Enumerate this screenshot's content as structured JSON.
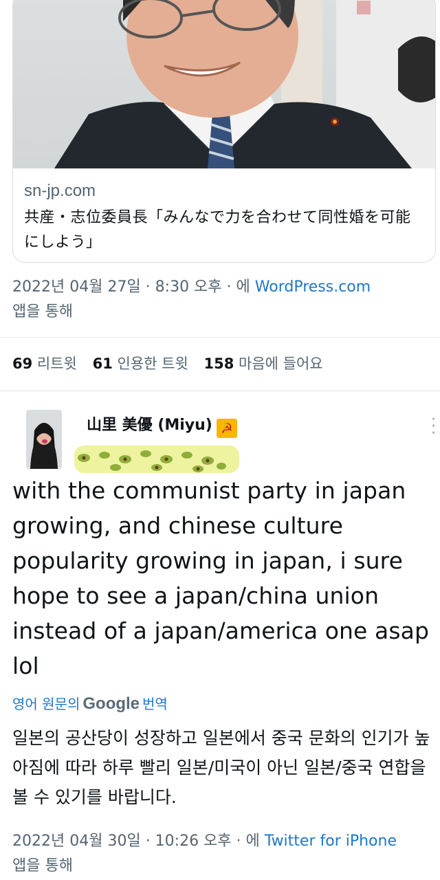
{
  "link_card": {
    "domain": "sn-jp.com",
    "title": "共産・志位委員長「みんなで力を合わせて同性婚を可能にしよう」"
  },
  "tweet1": {
    "timestamp": "2022년 04월 27일 · 8:30 오후 · 에",
    "source_app": "WordPress.com",
    "via_suffix": "앱을 통해",
    "stats": [
      {
        "count": "69",
        "label": "리트윗"
      },
      {
        "count": "61",
        "label": "인용한 트윗"
      },
      {
        "count": "158",
        "label": "마음에 들어요"
      }
    ]
  },
  "reply": {
    "author_name": "山里 美優 (Miyu)",
    "author_flag_icon": "hammer-sickle-flag-icon",
    "body_en": "with the communist party in japan growing, and chinese culture popularity growing in japan, i sure hope to see a japan/china union instead of a japan/america one asap lol",
    "translate_prefix": "영어 원문의",
    "translate_brand": "Google",
    "translate_suffix": "번역",
    "body_ko": "일본의 공산당이 성장하고 일본에서 중국 문화의 인기가 높아짐에 따라 하루 빨리 일본/미국이 아닌 일본/중국 연합을 볼 수 있기를 바랍니다.",
    "timestamp": "2022년 04월 30일 · 10:26 오후 · 에",
    "source_app": "Twitter for iPhone",
    "via_suffix": "앱을 통해"
  },
  "colors": {
    "link_blue": "#1d77c8",
    "muted_text": "#536471",
    "censor_highlight": "#eef3a0"
  }
}
